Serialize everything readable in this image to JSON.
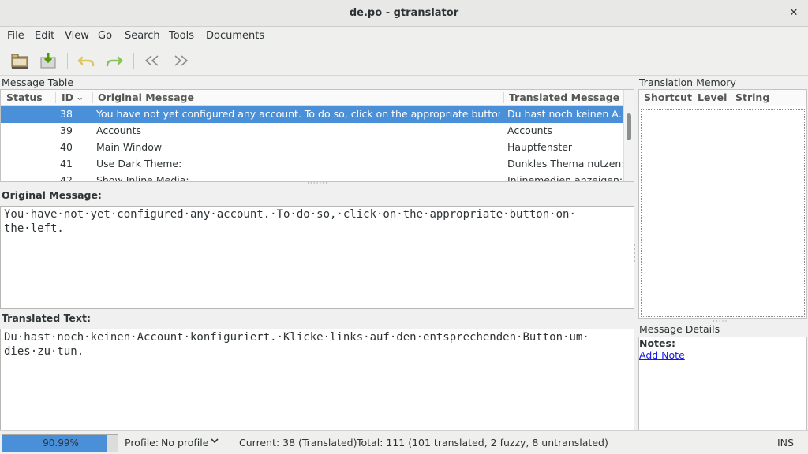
{
  "window": {
    "title": "de.po - gtranslator",
    "minimize": "–",
    "close": "✕"
  },
  "menu": [
    "File",
    "Edit",
    "View",
    "Go",
    "Search",
    "Tools",
    "Documents"
  ],
  "toolbar": {
    "icons": [
      "open-icon",
      "save-icon",
      "undo-icon",
      "redo-icon",
      "go-previous-icon",
      "go-next-icon"
    ]
  },
  "message_table": {
    "label": "Message Table",
    "columns": [
      "Status",
      "ID",
      "Original Message",
      "Translated Message"
    ],
    "sort_indicator": "⌄",
    "rows": [
      {
        "status": "",
        "id": "38",
        "original": "You have not yet configured any account. To do so, click on the appropriate button on …",
        "translated": "Du hast noch keinen A…",
        "selected": true
      },
      {
        "status": "",
        "id": "39",
        "original": "Accounts",
        "translated": "Accounts"
      },
      {
        "status": "",
        "id": "40",
        "original": "Main Window",
        "translated": "Hauptfenster"
      },
      {
        "status": "",
        "id": "41",
        "original": "Use Dark Theme:",
        "translated": "Dunkles Thema nutzen:"
      },
      {
        "status": "",
        "id": "42",
        "original": "Show Inline Media:",
        "translated": "Inlinemedien anzeigen:"
      }
    ]
  },
  "original": {
    "label": "Original Message:",
    "text": "You·have·not·yet·configured·any·account.·To·do·so,·click·on·the·appropriate·button·on· the·left."
  },
  "translated": {
    "label": "Translated Text:",
    "text": "Du·hast·noch·keinen·Account·konfiguriert.·Klicke·links·auf·den·entsprechenden·Button·um· dies·zu·tun."
  },
  "translation_memory": {
    "label": "Translation Memory",
    "columns": [
      "Shortcut",
      "Level",
      "String"
    ]
  },
  "message_details": {
    "label": "Message Details",
    "notes_label": "Notes:",
    "add_note": "Add Note"
  },
  "status": {
    "progress_text": "90.99%",
    "progress_value": 0.9099,
    "profile_label": "Profile:",
    "profile_value": "No profile",
    "current": "Current: 38 (Translated)",
    "total": "Total: 111 (101 translated, 2 fuzzy, 8 untranslated)",
    "mode": "INS"
  },
  "colors": {
    "selection": "#4a90d9",
    "link": "#1a1ae6"
  }
}
